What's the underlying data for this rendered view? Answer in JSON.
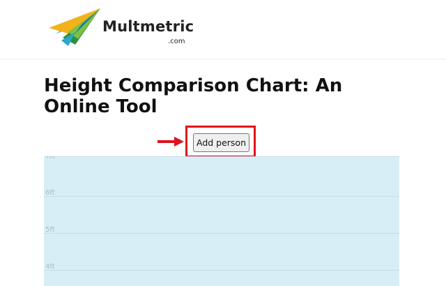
{
  "header": {
    "brand_name": "Multmetric",
    "brand_tld": ".com",
    "logo_icon": "paper-plane-logo-icon"
  },
  "main": {
    "title": "Height Comparison Chart: An Online Tool",
    "add_person_label": "Add person",
    "annotation": {
      "arrow_icon": "right-arrow-icon",
      "highlight_color": "#e0121b"
    }
  },
  "chart": {
    "background_color": "#d7eef6",
    "y_ticks": [
      "7ft",
      "6ft",
      "5ft",
      "4ft"
    ]
  }
}
